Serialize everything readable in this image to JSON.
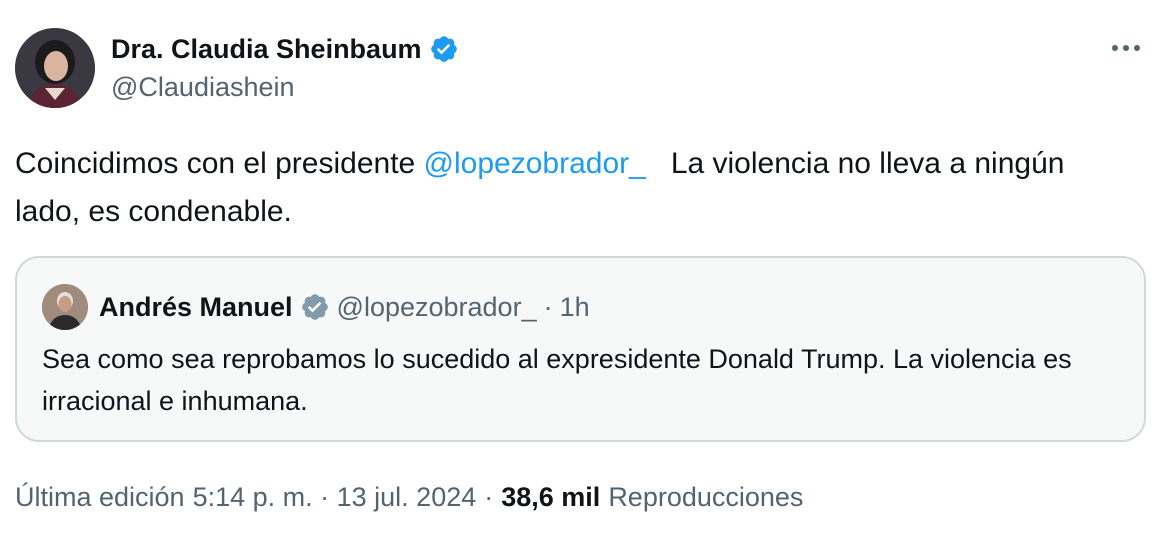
{
  "author": {
    "name": "Dra. Claudia Sheinbaum",
    "handle": "@Claudiashein",
    "verified": true
  },
  "tweet": {
    "text_before_mention": "Coincidimos con el presidente ",
    "mention": "@lopezobrador_",
    "text_after_mention": "   La violencia no lleva a ningún lado, es condenable."
  },
  "quoted_tweet": {
    "author_name": "Andrés Manuel",
    "handle": "@lopezobrador_",
    "separator": "·",
    "time": "1h",
    "text": "Sea como sea reprobamos lo sucedido al expresidente Donald Trump. La violencia es irracional e inhumana."
  },
  "meta": {
    "edited_label": "Última edición",
    "timestamp": "5:14 p. m. · 13 jul. 2024",
    "separator": "·",
    "views_count": "38,6 mil",
    "views_label": "Reproducciones"
  },
  "colors": {
    "accent": "#1d9bf0",
    "verified_blue": "#1d9bf0",
    "verified_gray": "#829aab",
    "secondary_text": "#536471"
  },
  "icons": {
    "more": "more-icon",
    "verified": "verified-badge-icon"
  }
}
